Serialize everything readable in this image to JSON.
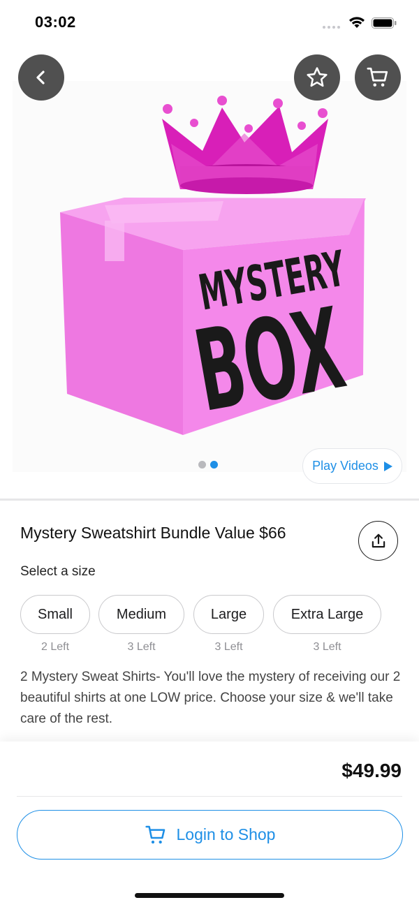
{
  "status_bar": {
    "time": "03:02"
  },
  "hero": {
    "image_text_line1": "MYSTERY",
    "image_text_line2": "BOX",
    "carousel_pages": 2,
    "carousel_active_index": 1,
    "play_videos_label": "Play Videos"
  },
  "product": {
    "title": "Mystery Sweatshirt Bundle Value $66",
    "select_size_label": "Select a size",
    "sizes": [
      {
        "label": "Small",
        "stock": "2 Left"
      },
      {
        "label": "Medium",
        "stock": "3 Left"
      },
      {
        "label": "Large",
        "stock": "3 Left"
      },
      {
        "label": "Extra Large",
        "stock": "3 Left"
      }
    ],
    "description": "2 Mystery Sweat Shirts- You'll love the mystery of receiving our 2 beautiful shirts at one LOW price. Choose your size & we'll take care of the rest."
  },
  "footer": {
    "price": "$49.99",
    "login_button_label": "Login to Shop"
  },
  "colors": {
    "accent": "#1e8fe6",
    "box_pink": "#f27fe8",
    "crown_magenta": "#d81fb8",
    "overlay_button": "#505050"
  },
  "icons": {
    "back": "chevron-left-icon",
    "favorite": "star-icon",
    "cart": "cart-icon",
    "share": "share-icon",
    "play": "play-icon"
  }
}
